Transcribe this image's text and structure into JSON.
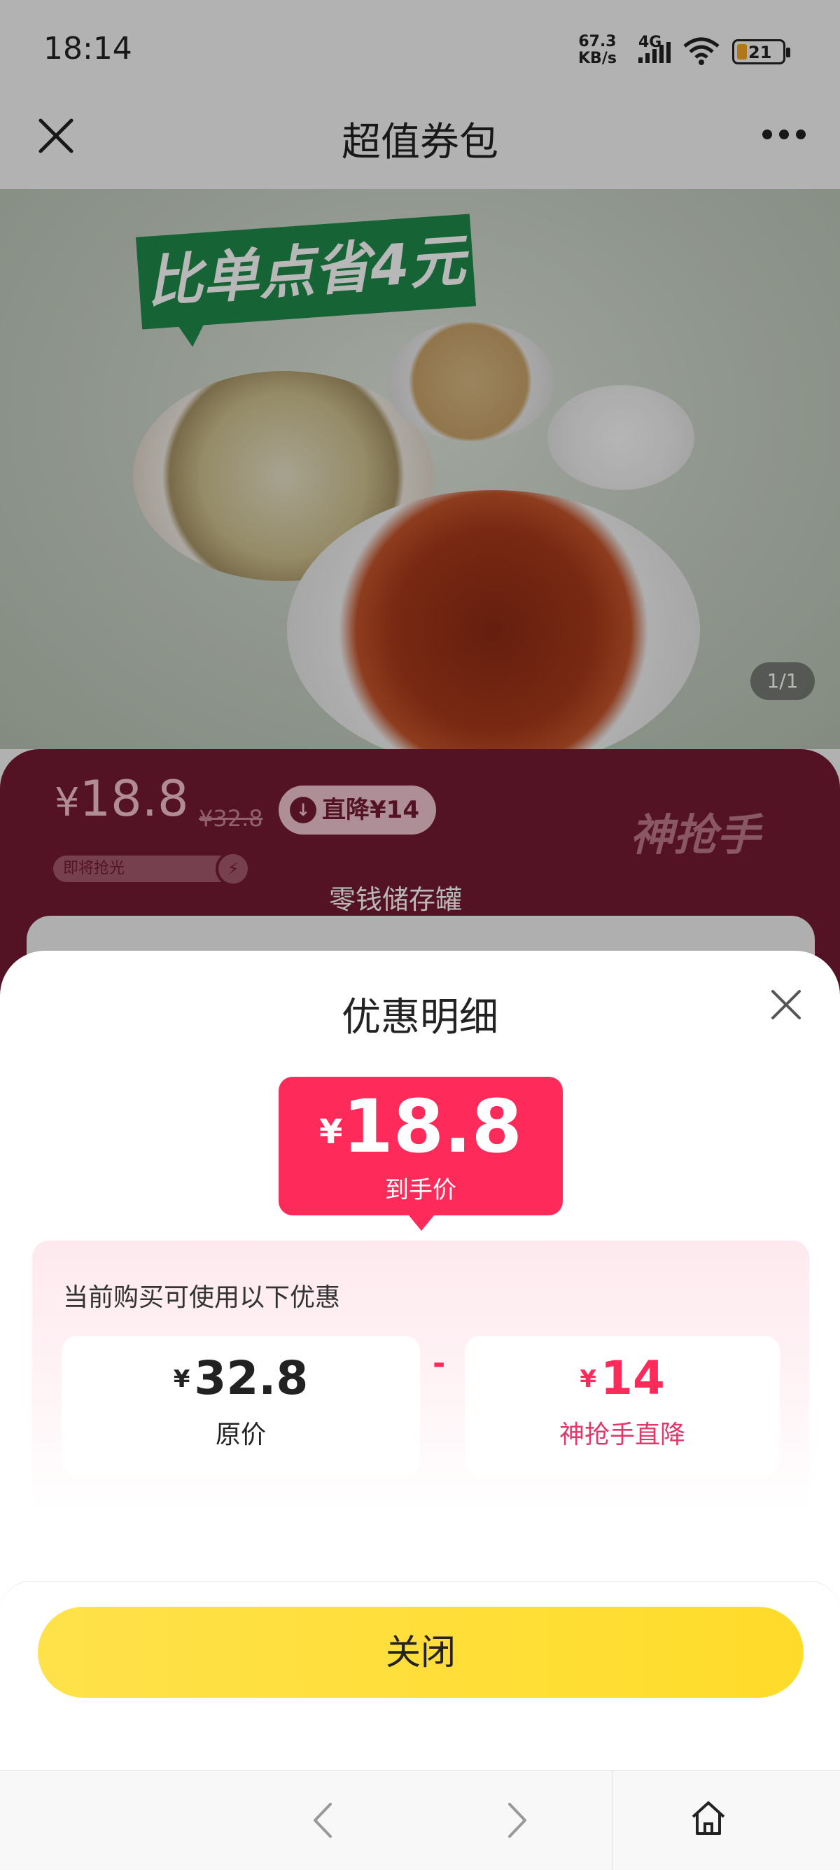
{
  "status_bar": {
    "time": "18:14",
    "net_speed_value": "67.3",
    "net_speed_unit": "KB/s",
    "network": "4G",
    "battery": "21"
  },
  "nav": {
    "title": "超值券包"
  },
  "hero": {
    "badge": "比单点省4元",
    "counter": "1/1"
  },
  "banner": {
    "currency": "¥",
    "price": "18.8",
    "original": "¥32.8",
    "drop_label": "直降¥14",
    "soon_label": "即将抢光",
    "brand": "神抢手",
    "subtitle": "零钱储存罐"
  },
  "sheet": {
    "title": "优惠明细",
    "final_currency": "¥",
    "final_price": "18.8",
    "final_label": "到手价",
    "detail_heading": "当前购买可使用以下优惠",
    "operator": "-",
    "left": {
      "currency": "¥",
      "value": "32.8",
      "label": "原价"
    },
    "right": {
      "currency": "¥",
      "value": "14",
      "label": "神抢手直降"
    },
    "close_button": "关闭"
  },
  "colors": {
    "accent": "#fd2a5a",
    "button": "#ffde33",
    "banner": "#741b33"
  }
}
